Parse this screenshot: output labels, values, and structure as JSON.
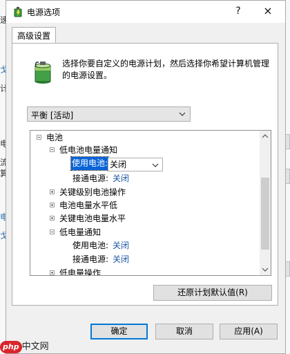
{
  "background": {
    "left_letters": [
      "速",
      "戈",
      "计",
      "电",
      "流",
      "算",
      "电",
      "戈"
    ]
  },
  "dialog": {
    "title": "电源选项",
    "help_glyph": "?",
    "close_glyph": "×",
    "tab_label": "高级设置",
    "description": "选择你要自定义的电源计划，然后选择你希望计算机管理的电源设置。",
    "plan_select": {
      "value": "平衡 [活动]"
    },
    "tree": {
      "items": [
        {
          "label": "电池"
        },
        {
          "label": "低电池电量通知"
        },
        {
          "prefix": "使用电池:",
          "value": "关闭"
        },
        {
          "prefix": "接通电源:",
          "value": "关闭"
        },
        {
          "label": "关键级别电池操作"
        },
        {
          "label": "电池电量水平低"
        },
        {
          "label": "关键电池电量水平"
        },
        {
          "label": "低电量通知"
        },
        {
          "prefix": "使用电池:",
          "value": "关闭"
        },
        {
          "prefix": "接通电源:",
          "value": "关闭"
        },
        {
          "label": "低电量操作"
        }
      ]
    },
    "restore_button": "还原计划默认值(R)",
    "ok_button": "确定",
    "cancel_button": "取消",
    "apply_button": "应用(A)"
  },
  "watermark": {
    "badge": "php",
    "text": "中文网"
  },
  "colors": {
    "accent": "#0078d7",
    "link_value": "#1a56a5",
    "selection": "#0a64d8"
  }
}
